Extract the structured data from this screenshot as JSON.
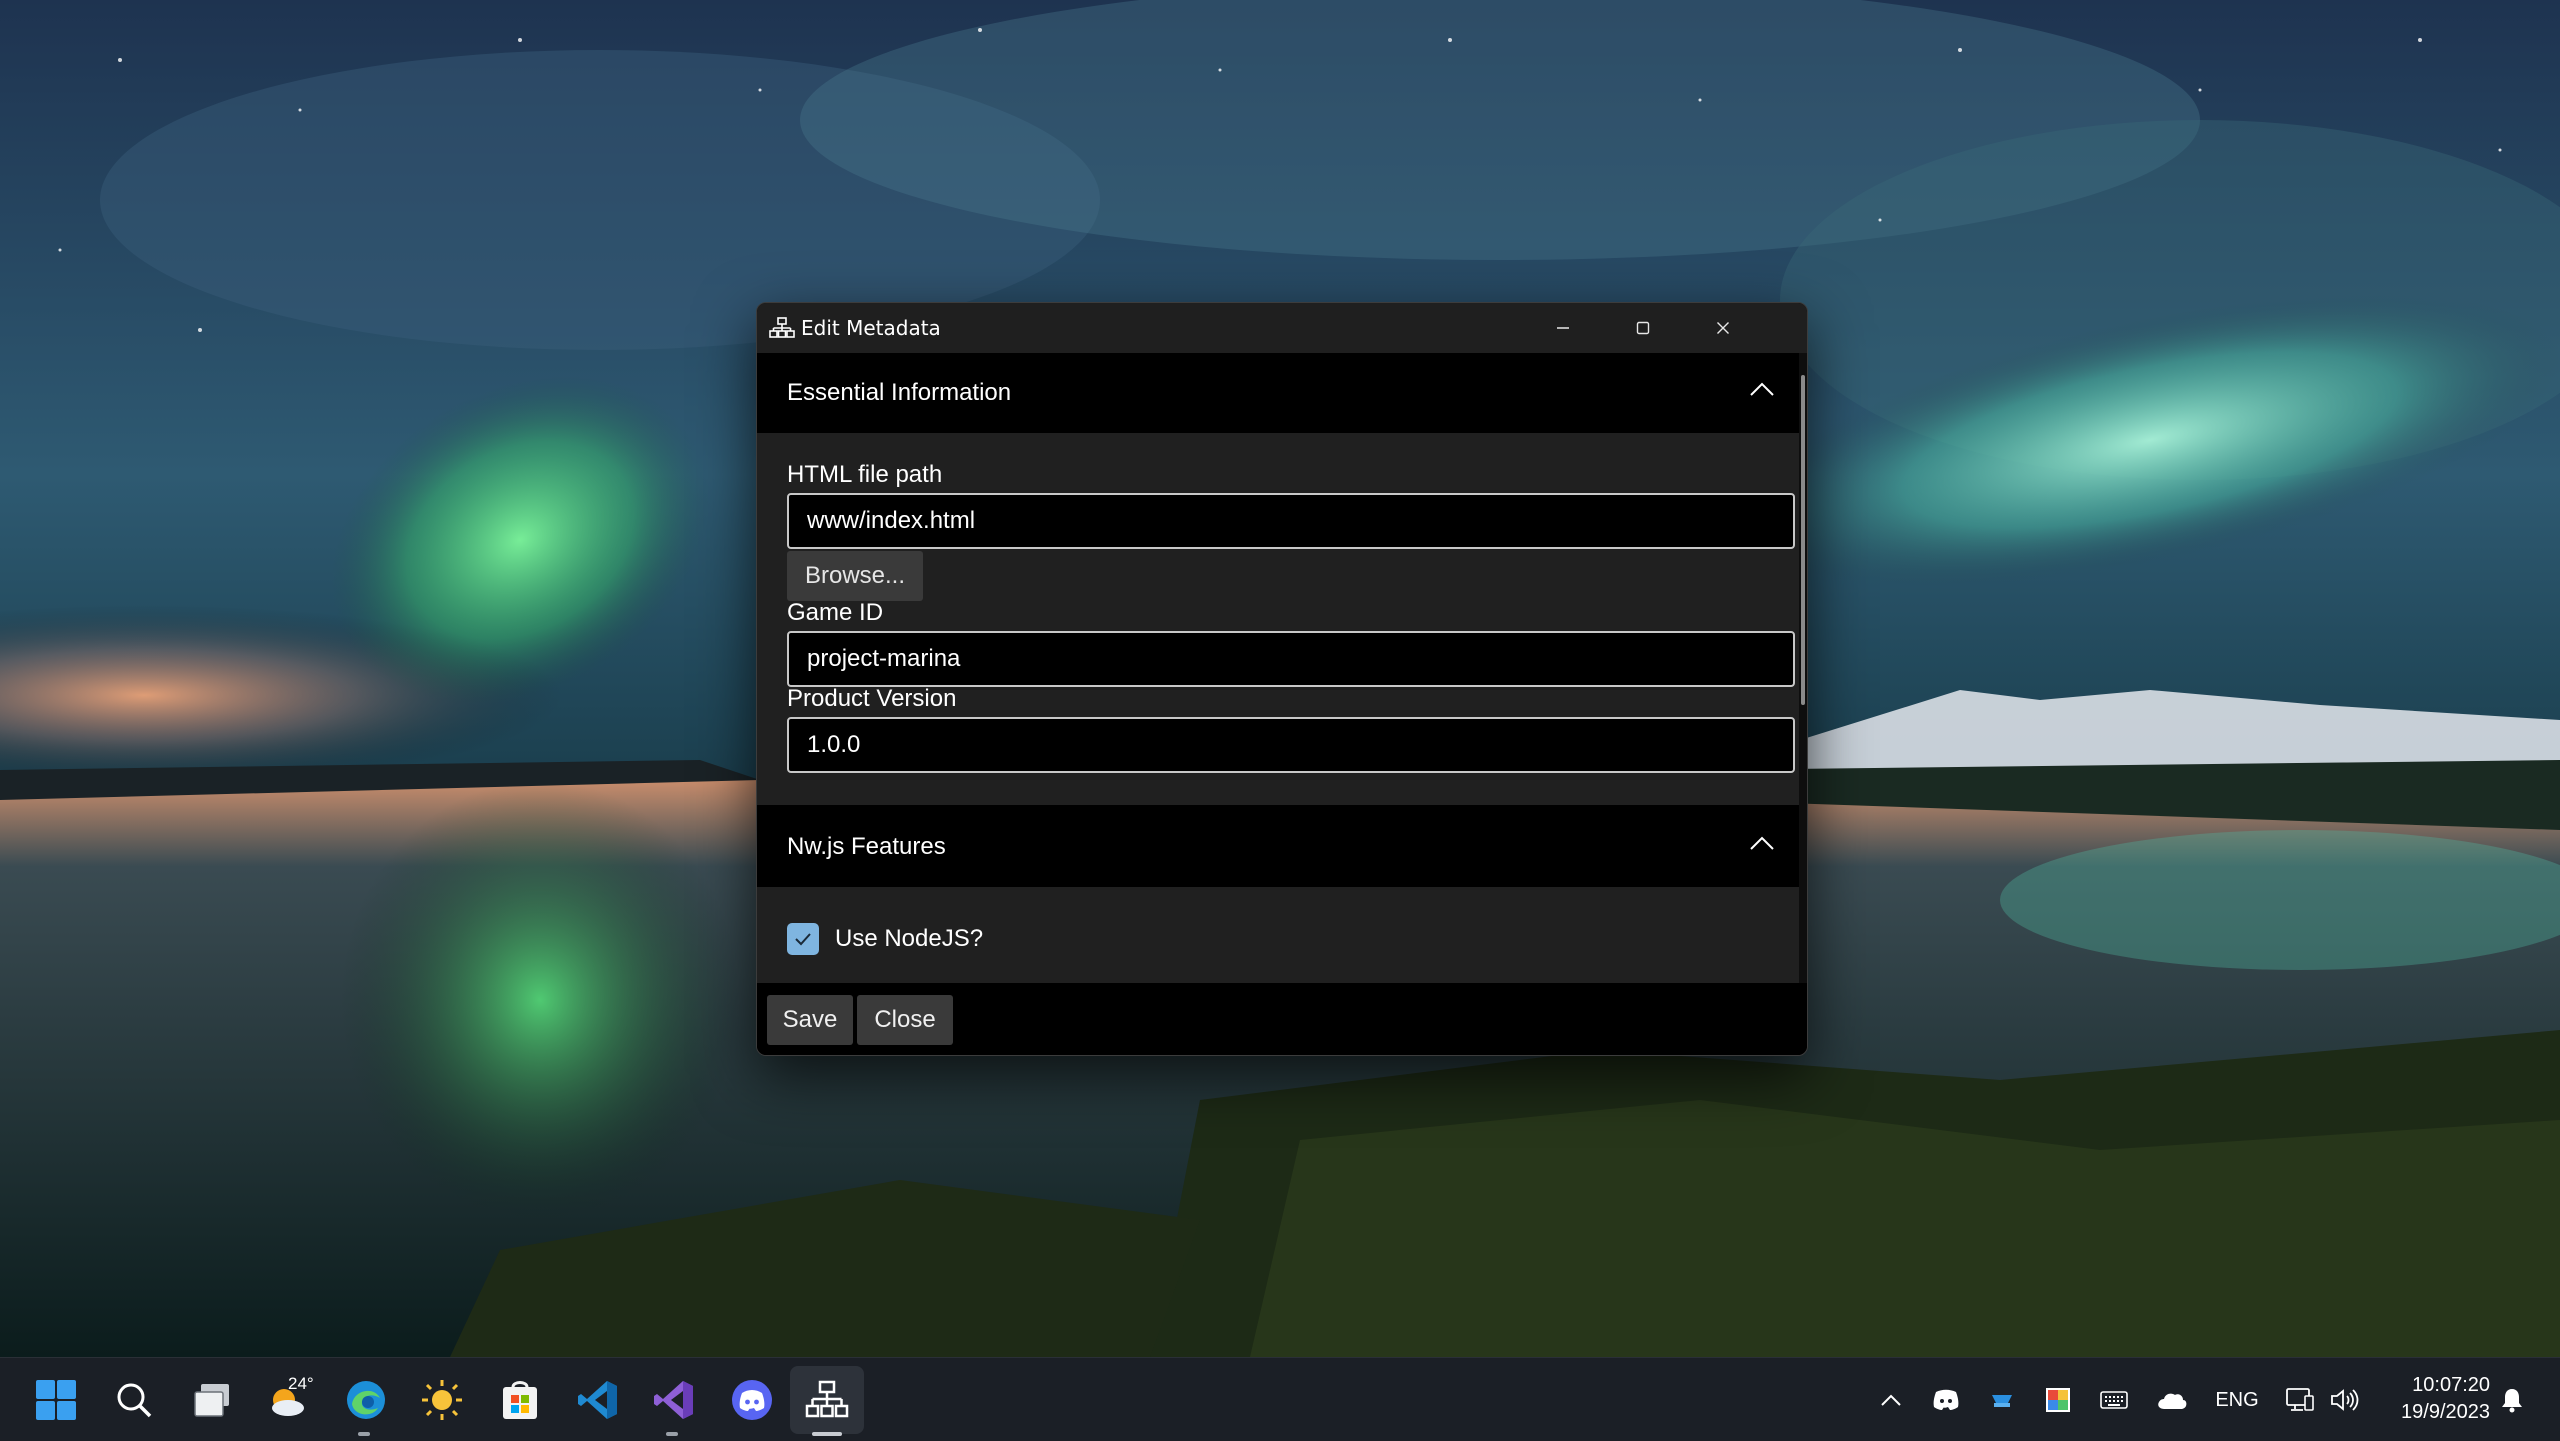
{
  "window": {
    "title": "Edit Metadata",
    "app_icon": "hierarchy-icon"
  },
  "essential": {
    "header": "Essential Information",
    "html_path_label": "HTML file path",
    "html_path_value": "www/index.html",
    "browse_label": "Browse...",
    "game_id_label": "Game ID",
    "game_id_value": "project-marina",
    "version_label": "Product Version",
    "version_value": "1.0.0"
  },
  "nwjs": {
    "header": "Nw.js Features",
    "use_nodejs_label": "Use NodeJS?",
    "use_nodejs_checked": true
  },
  "footer": {
    "save_label": "Save",
    "close_label": "Close"
  },
  "taskbar": {
    "apps": [
      "start-icon",
      "search-icon",
      "task-view-icon",
      "weather-icon",
      "edge-icon",
      "sun-app-icon",
      "store-icon",
      "vscode-icon",
      "visual-studio-icon",
      "discord-icon",
      "hierarchy-icon"
    ],
    "weather_temp": "24°",
    "language": "ENG",
    "time": "10:07:20",
    "date": "19/9/2023"
  },
  "colors": {
    "checkbox_accent": "#7fb5e0",
    "window_bg": "#000000",
    "section_body_bg": "#202020",
    "taskbar_bg": "#1b1f26"
  }
}
